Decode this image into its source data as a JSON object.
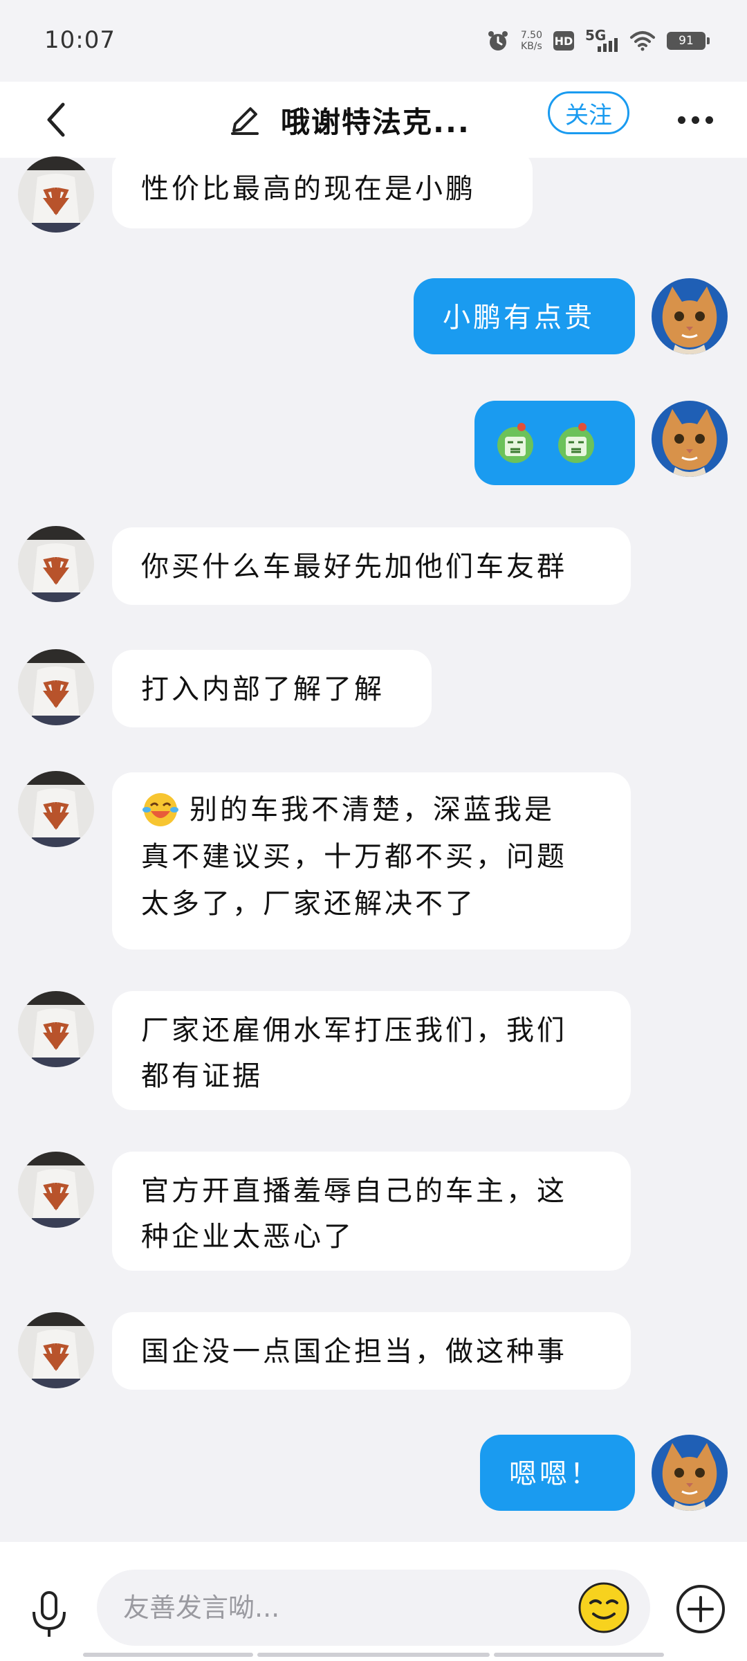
{
  "status_bar": {
    "time": "10:07",
    "speed_value": "7.50",
    "speed_unit": "KB/s",
    "hd_label": "HD",
    "network_label": "5G",
    "battery_level": "91",
    "icons": [
      "alarm-icon",
      "hd-icon",
      "signal-5g-icon",
      "wifi-icon",
      "battery-icon"
    ]
  },
  "header": {
    "title": "哦谢特法克...",
    "follow_label": "关注",
    "icons": [
      "back-icon",
      "edit-icon",
      "more-icon"
    ]
  },
  "messages": [
    {
      "side": "left",
      "text": "性价比最高的现在是小鹏"
    },
    {
      "side": "right",
      "text": "小鹏有点贵"
    },
    {
      "side": "right",
      "stickers": [
        "green-face-sticker",
        "green-face-sticker"
      ]
    },
    {
      "side": "left",
      "text": "你买什么车最好先加他们车友群"
    },
    {
      "side": "left",
      "text": "打入内部了解了解"
    },
    {
      "side": "left",
      "emoji": "laughing-crying-emoji",
      "lines": [
        "别的车我不清楚，深蓝我是",
        "真不建议买，十万都不买，问题",
        "太多了，厂家还解决不了"
      ]
    },
    {
      "side": "left",
      "lines": [
        "厂家还雇佣水军打压我们，我们",
        "都有证据"
      ]
    },
    {
      "side": "left",
      "lines": [
        "官方开直播羞辱自己的车主，这",
        "种企业太恶心了"
      ]
    },
    {
      "side": "left",
      "text": "国企没一点国企担当，做这种事"
    },
    {
      "side": "right",
      "text": "嗯嗯！"
    }
  ],
  "input_bar": {
    "placeholder": "友善发言呦...",
    "icons": [
      "mic-icon",
      "smiley-icon",
      "plus-icon"
    ]
  },
  "colors": {
    "accent": "#1a9bf0",
    "page_bg": "#f2f2f5",
    "bubble_in": "#ffffff"
  }
}
